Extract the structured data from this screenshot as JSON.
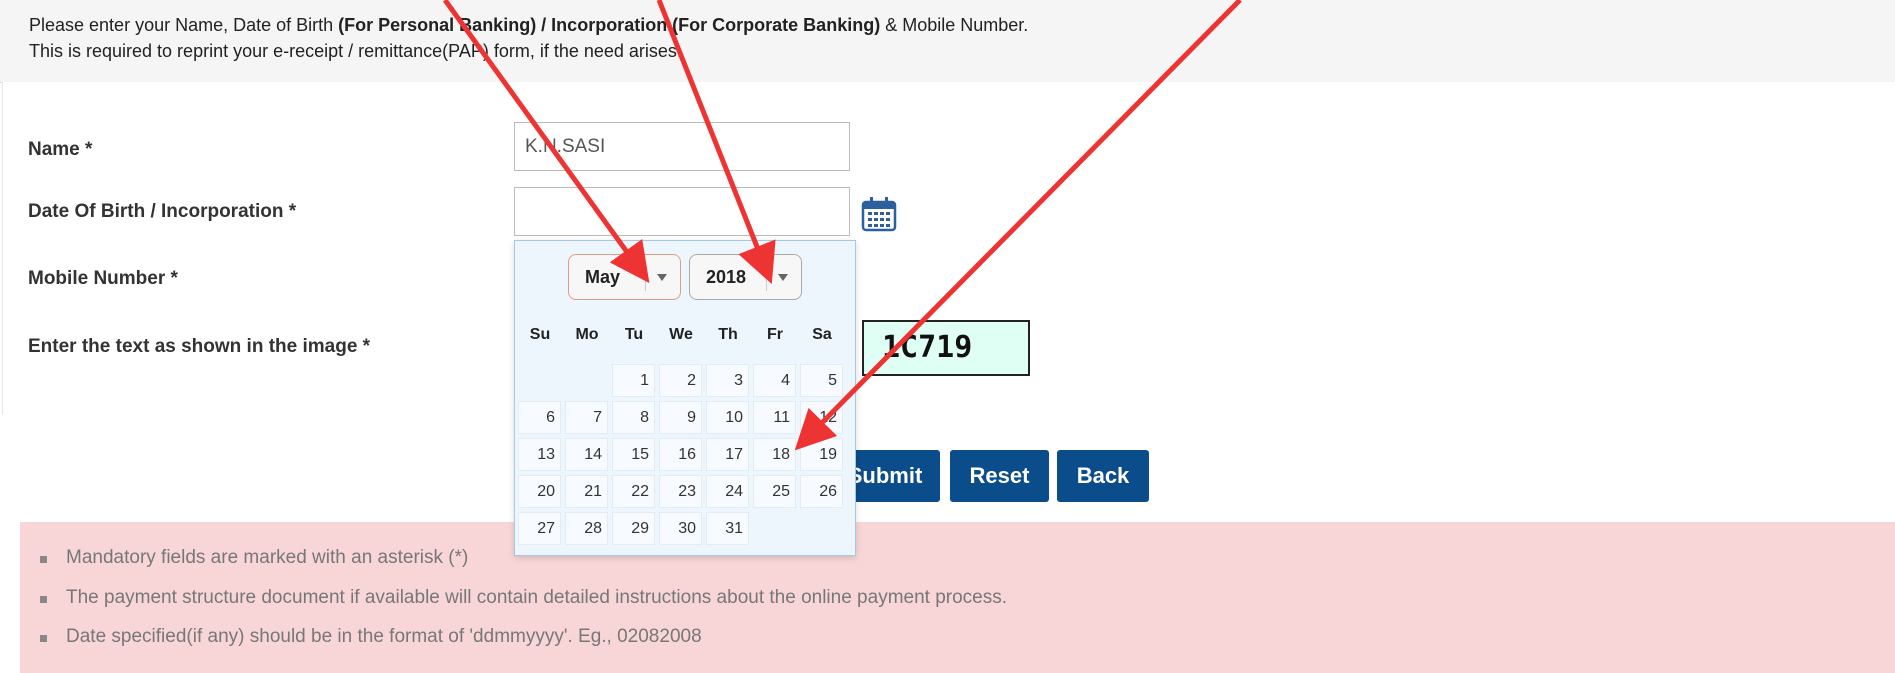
{
  "info": {
    "line1_pre": "Please enter your Name, Date of Birth ",
    "line1_bold": "(For Personal Banking) / Incorporation (For Corporate Banking)",
    "line1_post": "  & Mobile Number.",
    "line2": "This is required to reprint your e-receipt / remittance(PAP) form, if the need arises."
  },
  "form": {
    "name_label": "Name *",
    "name_value": "K.N.SASI",
    "dob_label": "Date Of Birth / Incorporation *",
    "dob_value": "",
    "mobile_label": "Mobile Number *",
    "captcha_label": "Enter the text as shown in the image *",
    "captcha_text": "1C719"
  },
  "datepicker": {
    "month": "May",
    "year": "2018",
    "weekdays": [
      "Su",
      "Mo",
      "Tu",
      "We",
      "Th",
      "Fr",
      "Sa"
    ],
    "first_weekday_index": 2,
    "days_in_month": 31
  },
  "buttons": {
    "submit": "Submit",
    "reset": "Reset",
    "back": "Back"
  },
  "notes": [
    "Mandatory fields are marked with an asterisk (*)",
    "The payment structure document if available will contain detailed instructions about the online payment process.",
    "Date specified(if any) should be in the format of 'ddmmyyyy'. Eg., 02082008"
  ],
  "colors": {
    "primary_button": "#0b4c8a",
    "notes_background": "#f8d6d8",
    "annotation_arrow": "#ee3333"
  },
  "icons": {
    "calendar": "calendar-icon"
  }
}
